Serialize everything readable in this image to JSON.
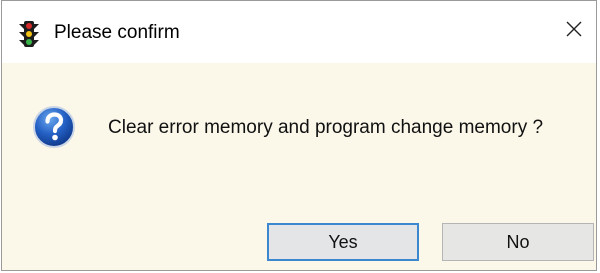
{
  "dialog": {
    "title": "Please confirm",
    "title_icon": "traffic-light-icon",
    "close_icon": "close-icon",
    "message_icon": "question-icon",
    "message": "Clear error memory and program change memory ?",
    "buttons": {
      "yes_label": "Yes",
      "no_label": "No"
    },
    "colors": {
      "dialog_background": "#fbf8ea",
      "titlebar_background": "#ffffff",
      "default_button_border": "#3c88d0",
      "button_background": "#e6e6e4",
      "question_icon_blue": "#1f5fbf"
    }
  }
}
